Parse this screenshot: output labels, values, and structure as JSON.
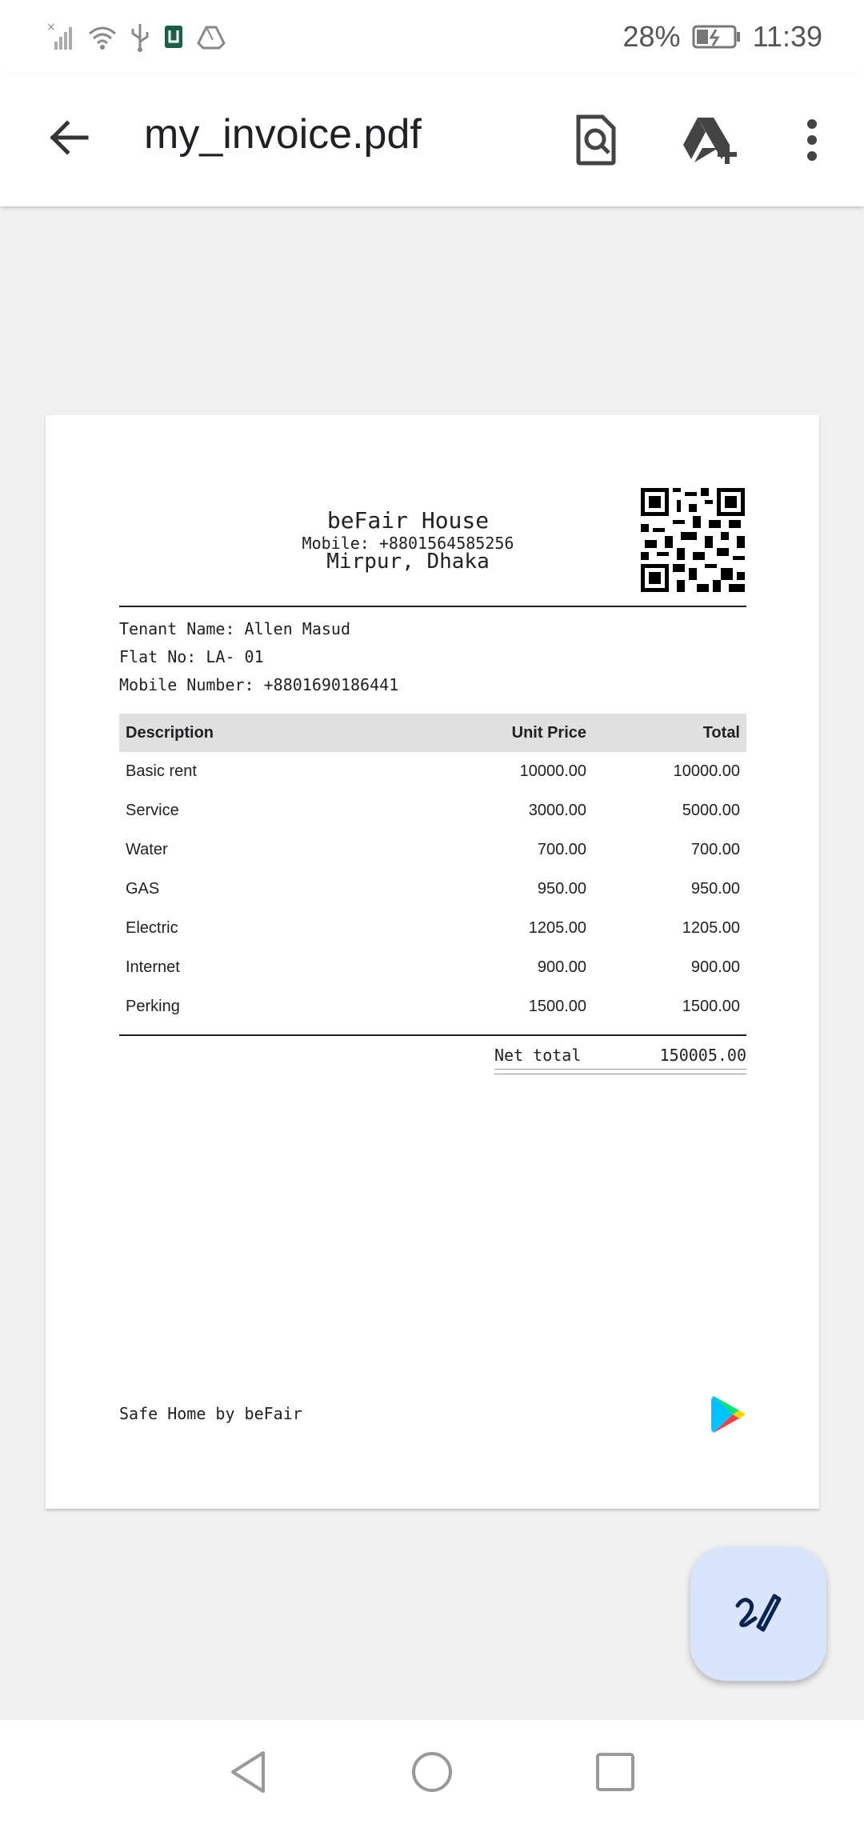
{
  "status_bar": {
    "battery": "28%",
    "time": "11:39",
    "icons": [
      "no-signal-icon",
      "wifi-icon",
      "usb-icon",
      "notification-app-icon",
      "drive-icon"
    ]
  },
  "app_bar": {
    "title": "my_invoice.pdf",
    "icons": [
      "back-arrow-icon",
      "find-in-document-icon",
      "add-to-drive-icon",
      "more-vert-icon"
    ]
  },
  "invoice": {
    "company_name": "beFair House",
    "company_mobile": "Mobile: +8801564585256",
    "company_address": "Mirpur, Dhaka",
    "tenant_name": "Tenant Name: Allen Masud",
    "flat_no": "Flat No: LA- 01",
    "mobile_number": "Mobile Number: +8801690186441",
    "table": {
      "headers": [
        "Description",
        "Unit Price",
        "Total"
      ],
      "rows": [
        [
          "Basic rent",
          "10000.00",
          "10000.00"
        ],
        [
          "Service",
          "3000.00",
          "5000.00"
        ],
        [
          "Water",
          "700.00",
          "700.00"
        ],
        [
          "GAS",
          "950.00",
          "950.00"
        ],
        [
          "Electric",
          "1205.00",
          "1205.00"
        ],
        [
          "Internet",
          "900.00",
          "900.00"
        ],
        [
          "Perking",
          "1500.00",
          "1500.00"
        ]
      ]
    },
    "net_total_label": "Net total",
    "net_total_value": "150005.00",
    "footer": "Safe Home by beFair"
  },
  "fab_icon": "annotate-pen-icon",
  "nav_icons": [
    "back-triangle-icon",
    "home-circle-icon",
    "recents-square-icon"
  ]
}
